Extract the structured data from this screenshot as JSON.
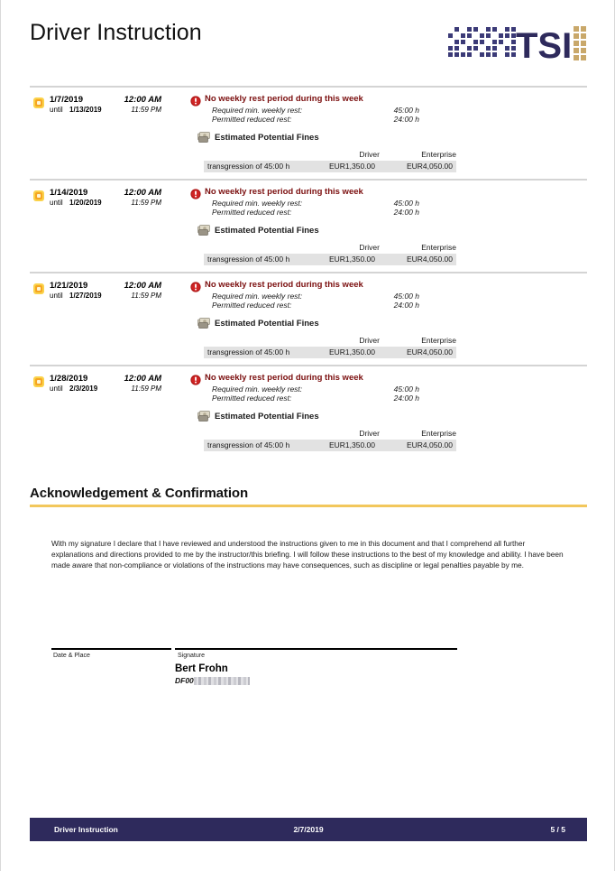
{
  "header": {
    "title": "Driver Instruction",
    "logo": {
      "wordmark": "TSI",
      "dot_color": "#3b3a77",
      "text_color": "#2e2a5c",
      "grid_color": "#c9a86a"
    }
  },
  "entries": [
    {
      "start_date": "1/7/2019",
      "start_time": "12:00 AM",
      "until_label": "until",
      "end_date": "1/13/2019",
      "end_time": "11:59 PM",
      "violation_title": "No weekly rest period during this week",
      "details": [
        {
          "label": "Required min. weekly rest:",
          "value": "45:00 h"
        },
        {
          "label": "Permitted reduced rest:",
          "value": "24:00 h"
        }
      ],
      "fines_title": "Estimated Potential Fines",
      "fines_columns": [
        "Driver",
        "Enterprise"
      ],
      "fines_rows": [
        {
          "description": "transgression of 45:00 h",
          "driver": "EUR1,350.00",
          "enterprise": "EUR4,050.00"
        }
      ]
    },
    {
      "start_date": "1/14/2019",
      "start_time": "12:00 AM",
      "until_label": "until",
      "end_date": "1/20/2019",
      "end_time": "11:59 PM",
      "violation_title": "No weekly rest period during this week",
      "details": [
        {
          "label": "Required min. weekly rest:",
          "value": "45:00 h"
        },
        {
          "label": "Permitted reduced rest:",
          "value": "24:00 h"
        }
      ],
      "fines_title": "Estimated Potential Fines",
      "fines_columns": [
        "Driver",
        "Enterprise"
      ],
      "fines_rows": [
        {
          "description": "transgression of 45:00 h",
          "driver": "EUR1,350.00",
          "enterprise": "EUR4,050.00"
        }
      ]
    },
    {
      "start_date": "1/21/2019",
      "start_time": "12:00 AM",
      "until_label": "until",
      "end_date": "1/27/2019",
      "end_time": "11:59 PM",
      "violation_title": "No weekly rest period during this week",
      "details": [
        {
          "label": "Required min. weekly rest:",
          "value": "45:00 h"
        },
        {
          "label": "Permitted reduced rest:",
          "value": "24:00 h"
        }
      ],
      "fines_title": "Estimated Potential Fines",
      "fines_columns": [
        "Driver",
        "Enterprise"
      ],
      "fines_rows": [
        {
          "description": "transgression of 45:00 h",
          "driver": "EUR1,350.00",
          "enterprise": "EUR4,050.00"
        }
      ]
    },
    {
      "start_date": "1/28/2019",
      "start_time": "12:00 AM",
      "until_label": "until",
      "end_date": "2/3/2019",
      "end_time": "11:59 PM",
      "violation_title": "No weekly rest period during this week",
      "details": [
        {
          "label": "Required min. weekly rest:",
          "value": "45:00 h"
        },
        {
          "label": "Permitted reduced rest:",
          "value": "24:00 h"
        }
      ],
      "fines_title": "Estimated Potential Fines",
      "fines_columns": [
        "Driver",
        "Enterprise"
      ],
      "fines_rows": [
        {
          "description": "transgression of 45:00 h",
          "driver": "EUR1,350.00",
          "enterprise": "EUR4,050.00"
        }
      ]
    }
  ],
  "acknowledgement": {
    "title": "Acknowledgement & Confirmation",
    "rule_color": "#f2c75c",
    "body": "With my signature I declare that I have reviewed and understood the instructions given to me in this document and that I comprehend all further explanations and directions provided to me by the instructor/this briefing. I will follow these instructions to the best of my knowledge and ability. I have been made aware that non-compliance or violations of the instructions may have consequences, such as discipline or legal penalties payable by me."
  },
  "signature": {
    "date_place_label": "Date & Place",
    "signature_label": "Signature",
    "driver_name": "Bert Frohn",
    "driver_id_prefix": "DF00"
  },
  "footer": {
    "left": "Driver Instruction",
    "date": "2/7/2019",
    "page": "5 / 5",
    "background": "#2e2a5c"
  },
  "icons": {
    "sun": "sun-icon",
    "alert": "alert-error-icon",
    "fines": "money-icon"
  }
}
